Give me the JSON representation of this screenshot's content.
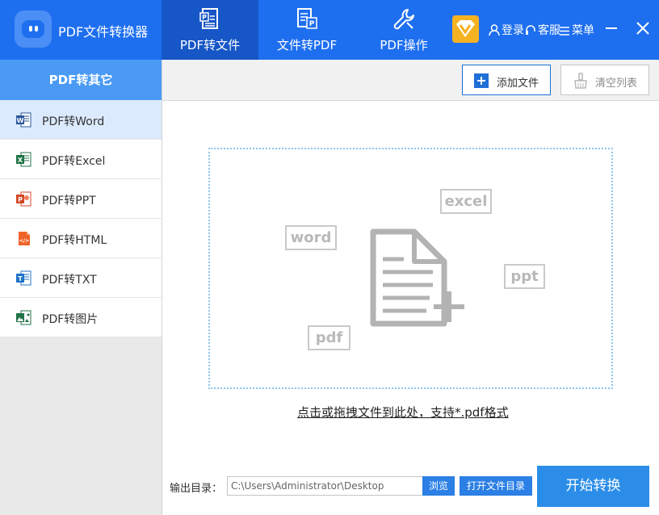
{
  "app": {
    "title": "PDF文件转换器"
  },
  "nav": {
    "tabs": [
      {
        "label": "PDF转文件",
        "icon": "pdf-to-file-icon",
        "active": true
      },
      {
        "label": "文件转PDF",
        "icon": "file-to-pdf-icon",
        "active": false
      },
      {
        "label": "PDF操作",
        "icon": "wrench-icon",
        "active": false
      }
    ]
  },
  "header_actions": {
    "login": "登录",
    "service": "客服",
    "menu": "菜单"
  },
  "sidebar": {
    "title": "PDF转其它",
    "items": [
      {
        "label": "PDF转Word",
        "icon": "word-icon",
        "color": "#2b579a",
        "letter": "W",
        "active": true
      },
      {
        "label": "PDF转Excel",
        "icon": "excel-icon",
        "color": "#217346",
        "letter": "X",
        "active": false
      },
      {
        "label": "PDF转PPT",
        "icon": "ppt-icon",
        "color": "#d24726",
        "letter": "P",
        "active": false
      },
      {
        "label": "PDF转HTML",
        "icon": "html-icon",
        "color": "#f0642a",
        "letter": "</>",
        "active": false
      },
      {
        "label": "PDF转TXT",
        "icon": "txt-icon",
        "color": "#1e73c9",
        "letter": "T",
        "active": false
      },
      {
        "label": "PDF转图片",
        "icon": "image-icon",
        "color": "#217346",
        "letter": "▲",
        "active": false
      }
    ]
  },
  "toolbar": {
    "add_file": "添加文件",
    "clear_list": "清空列表"
  },
  "dropzone": {
    "tags": {
      "word": "word",
      "excel": "excel",
      "ppt": "ppt",
      "pdf": "pdf"
    },
    "hint": "点击或拖拽文件到此处，支持*.pdf格式"
  },
  "footer": {
    "output_label": "输出目录：",
    "output_path": "C:\\Users\\Administrator\\Desktop",
    "browse": "浏览",
    "open_dir": "打开文件目录",
    "start": "开始转换"
  },
  "colors": {
    "header_bg": "#1e6ff0",
    "active_tab_bg": "#1656c6",
    "sidebar_title_bg": "#4a9af4",
    "active_item_bg": "#dbeafc",
    "primary_button": "#2b8de8",
    "dropzone_border": "#8ec4ec"
  }
}
